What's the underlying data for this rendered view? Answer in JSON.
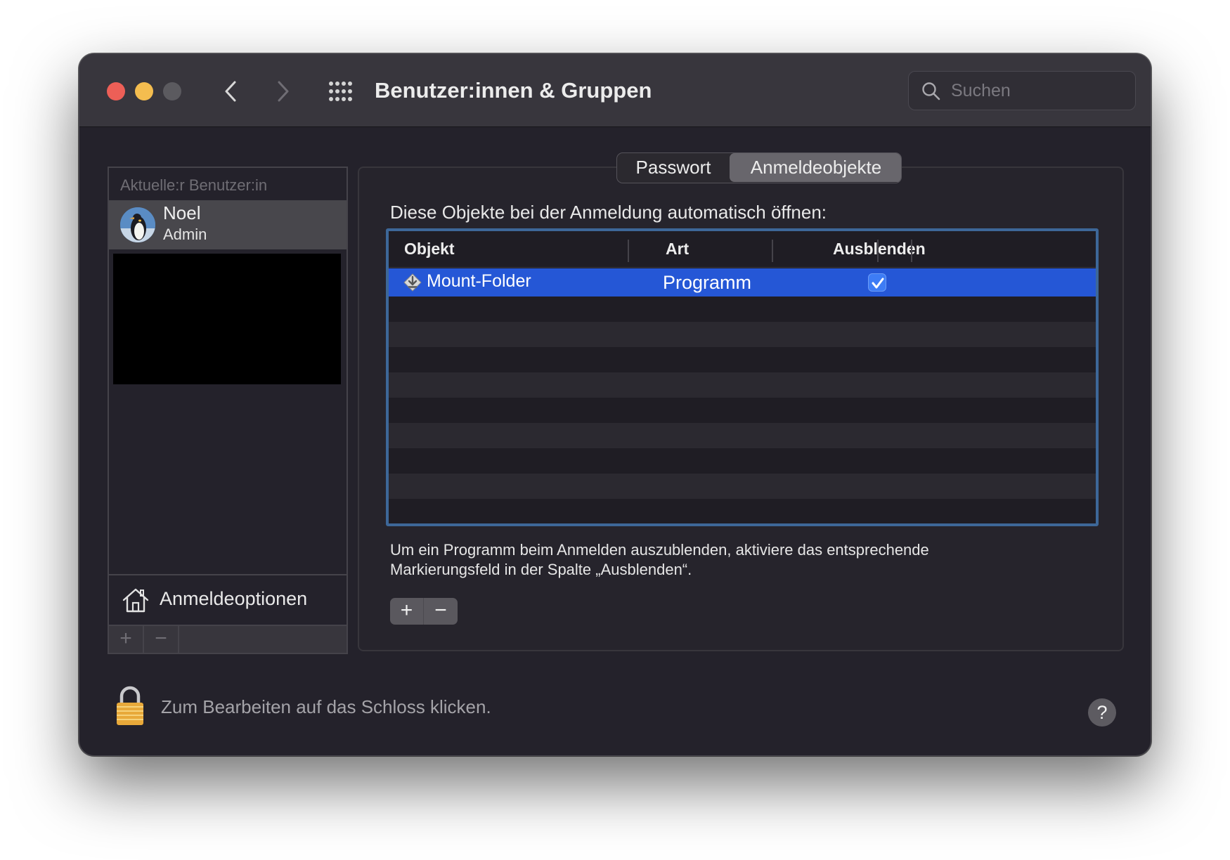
{
  "window": {
    "title": "Benutzer:innen & Gruppen"
  },
  "search": {
    "placeholder": "Suchen"
  },
  "sidebar": {
    "section_label": "Aktuelle:r Benutzer:in",
    "user": {
      "name": "Noel",
      "role": "Admin"
    },
    "login_options_label": "Anmeldeoptionen",
    "add_label": "+",
    "remove_label": "−"
  },
  "tabs": [
    {
      "label": "Passwort",
      "selected": false
    },
    {
      "label": "Anmeldeobjekte",
      "selected": true
    }
  ],
  "panel": {
    "heading": "Diese Objekte bei der Anmeldung automatisch öffnen:",
    "hint": "Um ein Programm beim Anmelden auszublenden, aktiviere das entsprechende Markierungsfeld in der Spalte „Ausblenden“.",
    "add_label": "+",
    "remove_label": "−"
  },
  "table": {
    "columns": [
      "Objekt",
      "Art",
      "Ausblenden"
    ],
    "rows": [
      {
        "object": "Mount-Folder",
        "type": "Programm",
        "hidden": true,
        "icon": "app-installer-icon"
      }
    ]
  },
  "footer": {
    "lock_text": "Zum Bearbeiten auf das Schloss klicken.",
    "help_label": "?"
  },
  "colors": {
    "selection": "#2557d6",
    "checkbox": "#3d7cf5",
    "table_focus_ring": "#3d6798",
    "close": "#ed5f57",
    "minimize": "#f4bd4f"
  }
}
